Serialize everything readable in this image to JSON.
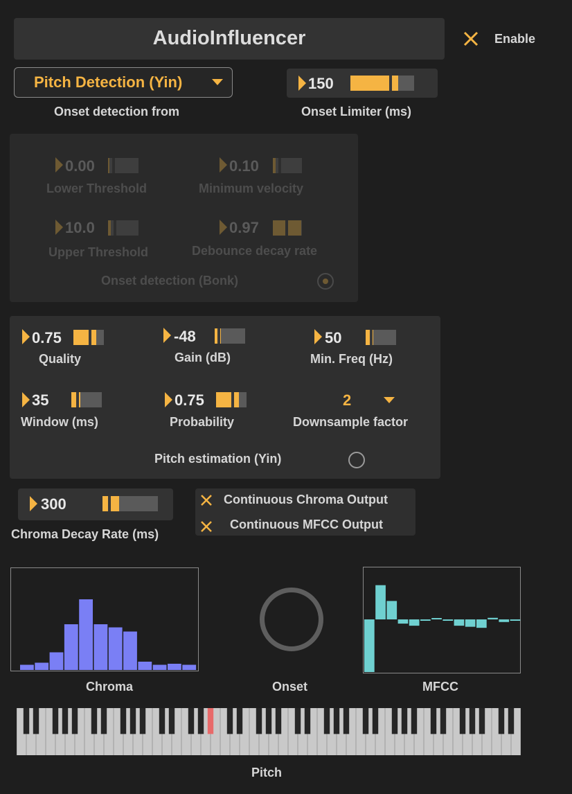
{
  "header": {
    "title": "AudioInfluencer",
    "enable_label": "Enable"
  },
  "onset_source": {
    "selected": "Pitch Detection (Yin)",
    "label": "Onset detection from"
  },
  "onset_limiter": {
    "value": "150",
    "label": "Onset Limiter (ms)",
    "level": 0.75
  },
  "bonk": {
    "title": "Onset detection (Bonk)",
    "lower_threshold": {
      "value": "0.00",
      "label": "Lower Threshold",
      "level": 0.05
    },
    "minimum_velocity": {
      "value": "0.10",
      "label": "Minimum velocity",
      "level": 0.1
    },
    "upper_threshold": {
      "value": "10.0",
      "label": "Upper Threshold",
      "level": 0.1
    },
    "debounce_decay": {
      "value": "0.97",
      "label": "Debounce decay rate",
      "level": 0.97
    }
  },
  "yin": {
    "title": "Pitch estimation (Yin)",
    "quality": {
      "value": "0.75",
      "label": "Quality",
      "level": 0.75
    },
    "gain": {
      "value": "-48",
      "label": "Gain (dB)",
      "level": 0.2
    },
    "min_freq": {
      "value": "50",
      "label": "Min. Freq (Hz)",
      "level": 0.25
    },
    "window": {
      "value": "35",
      "label": "Window (ms)",
      "level": 0.3
    },
    "probability": {
      "value": "0.75",
      "label": "Probability",
      "level": 0.75
    },
    "downsample": {
      "value": "2",
      "label": "Downsample factor"
    }
  },
  "chroma_decay": {
    "value": "300",
    "label": "Chroma Decay Rate (ms)",
    "level": 0.3
  },
  "options": {
    "continuous_chroma": "Continuous Chroma Output",
    "continuous_mfcc": "Continuous MFCC Output"
  },
  "displays": {
    "chroma_label": "Chroma",
    "onset_label": "Onset",
    "mfcc_label": "MFCC",
    "pitch_label": "Pitch"
  },
  "colors": {
    "accent": "#f5b443",
    "chroma_bars": "#7a7ff5",
    "mfcc_bars": "#6fd0d0",
    "key_highlight": "#e86a6a"
  },
  "chart_data": [
    {
      "type": "bar",
      "label": "Chroma",
      "values": [
        0.05,
        0.07,
        0.17,
        0.44,
        0.68,
        0.44,
        0.41,
        0.37,
        0.08,
        0.05,
        0.06,
        0.05
      ],
      "ylim": [
        0,
        1
      ]
    },
    {
      "type": "bar",
      "label": "MFCC",
      "values": [
        -1.0,
        0.65,
        0.35,
        -0.08,
        -0.12,
        -0.02,
        0.02,
        -0.02,
        -0.12,
        -0.14,
        -0.16,
        0.03,
        -0.05,
        -0.01
      ],
      "ylim": [
        -1,
        1
      ]
    }
  ],
  "piano": {
    "highlighted_key": 19
  }
}
